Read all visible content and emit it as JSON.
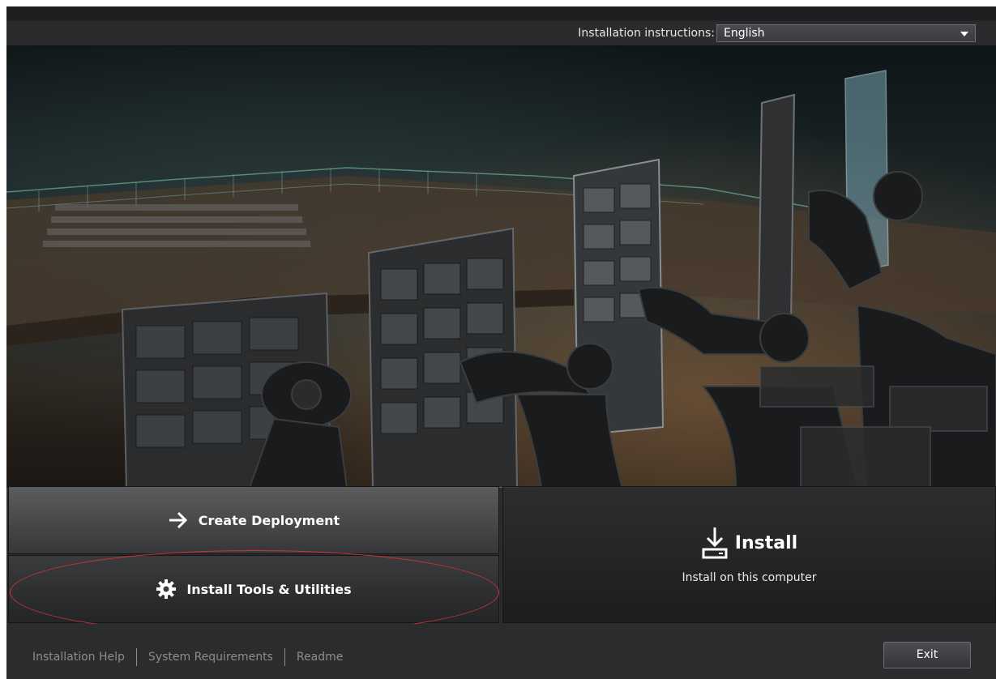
{
  "topbar": {
    "language_label": "Installation instructions:",
    "language_selected": "English"
  },
  "actions": {
    "create_deployment": {
      "label": "Create Deployment",
      "icon": "arrow-right-icon"
    },
    "install_tools": {
      "label": "Install Tools & Utilities",
      "icon": "gear-icon"
    },
    "install": {
      "label": "Install",
      "sublabel": "Install on this computer",
      "icon": "download-icon"
    }
  },
  "footer": {
    "links": [
      "Installation Help",
      "System Requirements",
      "Readme"
    ],
    "exit_label": "Exit"
  },
  "colors": {
    "background": "#2b2c2e",
    "highlight": "#d23232",
    "footer_text": "#8c8d8f"
  }
}
